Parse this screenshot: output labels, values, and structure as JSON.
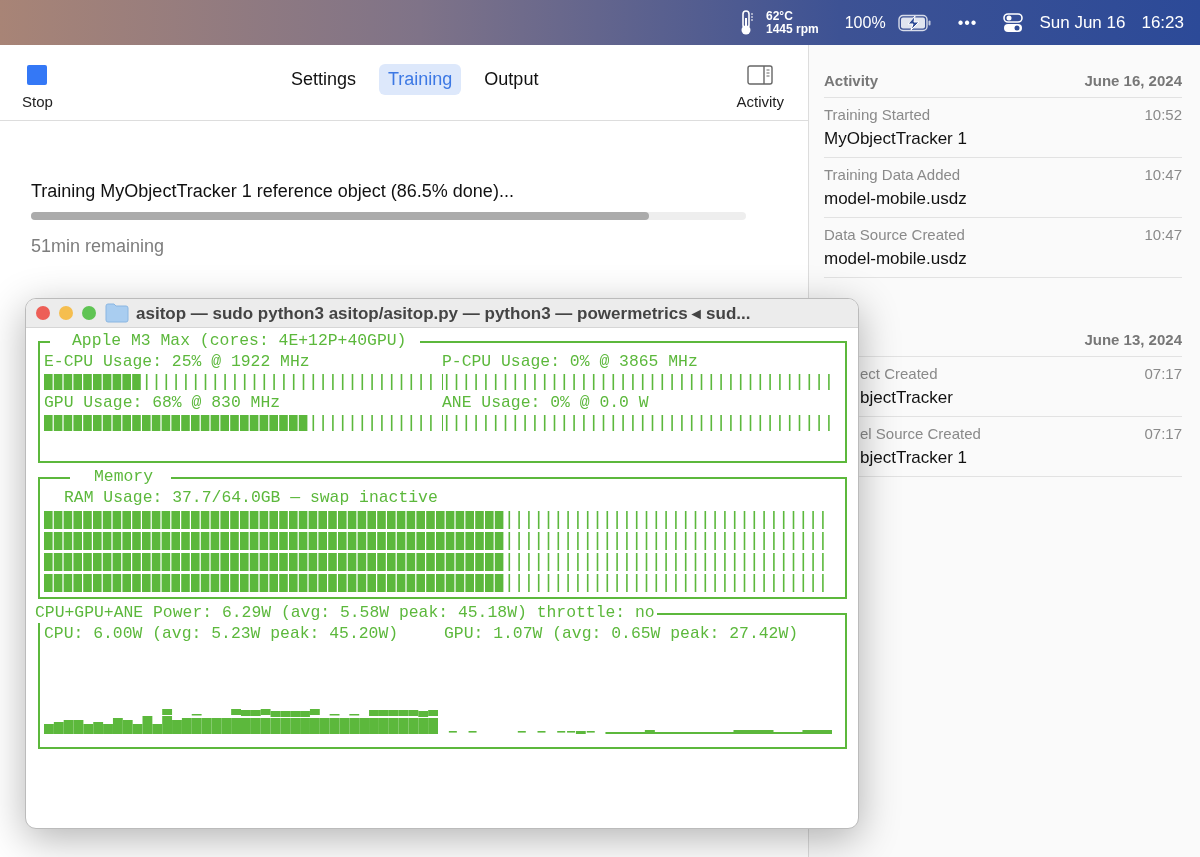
{
  "menu_bar": {
    "temperature": "62°C",
    "fan_speed": "1445 rpm",
    "battery": "100%",
    "more": "•••",
    "date": "Sun Jun 16",
    "time": "16:23"
  },
  "toolbar": {
    "stop": "Stop",
    "tabs": [
      {
        "label": "Settings",
        "selected": false
      },
      {
        "label": "Training",
        "selected": true
      },
      {
        "label": "Output",
        "selected": false
      }
    ],
    "activity": "Activity"
  },
  "training": {
    "status": "Training MyObjectTracker 1 reference object (86.5% done)...",
    "level": 0.865,
    "remaining": "51min remaining"
  },
  "activity": {
    "title": "Activity",
    "groups": [
      {
        "date": "June 16, 2024",
        "items": [
          {
            "event": "Training Started",
            "time": "10:52",
            "subject": "MyObjectTracker 1"
          },
          {
            "event": "Training Data Added",
            "time": "10:47",
            "subject": "model-mobile.usdz"
          },
          {
            "event": "Data Source Created",
            "time": "10:47",
            "subject": "model-mobile.usdz"
          }
        ]
      },
      {
        "date": "June 13, 2024",
        "items": [
          {
            "event": "ect Created",
            "time": "07:17",
            "subject": "bjectTracker"
          },
          {
            "event": "el Source Created",
            "time": "07:17",
            "subject": "bjectTracker 1"
          }
        ]
      }
    ]
  },
  "terminal": {
    "title": "asitop — sudo python3 asitop/asitop.py — python3 — powermetrics ◂ sud...",
    "processor": {
      "title": "Apple M3 Max (cores: 4E+12P+40GPU)",
      "gauges": [
        {
          "label": "E-CPU Usage: 25% @ 1922 MHz",
          "level": 0.25
        },
        {
          "label": "P-CPU Usage: 0% @ 3865 MHz",
          "level": 0
        },
        {
          "label": "GPU Usage: 68% @ 830 MHz",
          "level": 0.68
        },
        {
          "label": "ANE Usage: 0% @ 0.0 W",
          "level": 0
        }
      ]
    },
    "memory": {
      "title": "Memory",
      "label": "RAM Usage: 37.7/64.0GB — swap inactive",
      "level": 0.59
    },
    "power": {
      "title": "CPU+GPU+ANE Power: 6.29W (avg: 5.58W peak: 45.18W) throttle: no",
      "cpu": "CPU: 6.00W (avg: 5.23W peak: 45.20W)",
      "gpu": "GPU: 1.07W (avg: 0.65W peak: 27.42W)"
    }
  }
}
